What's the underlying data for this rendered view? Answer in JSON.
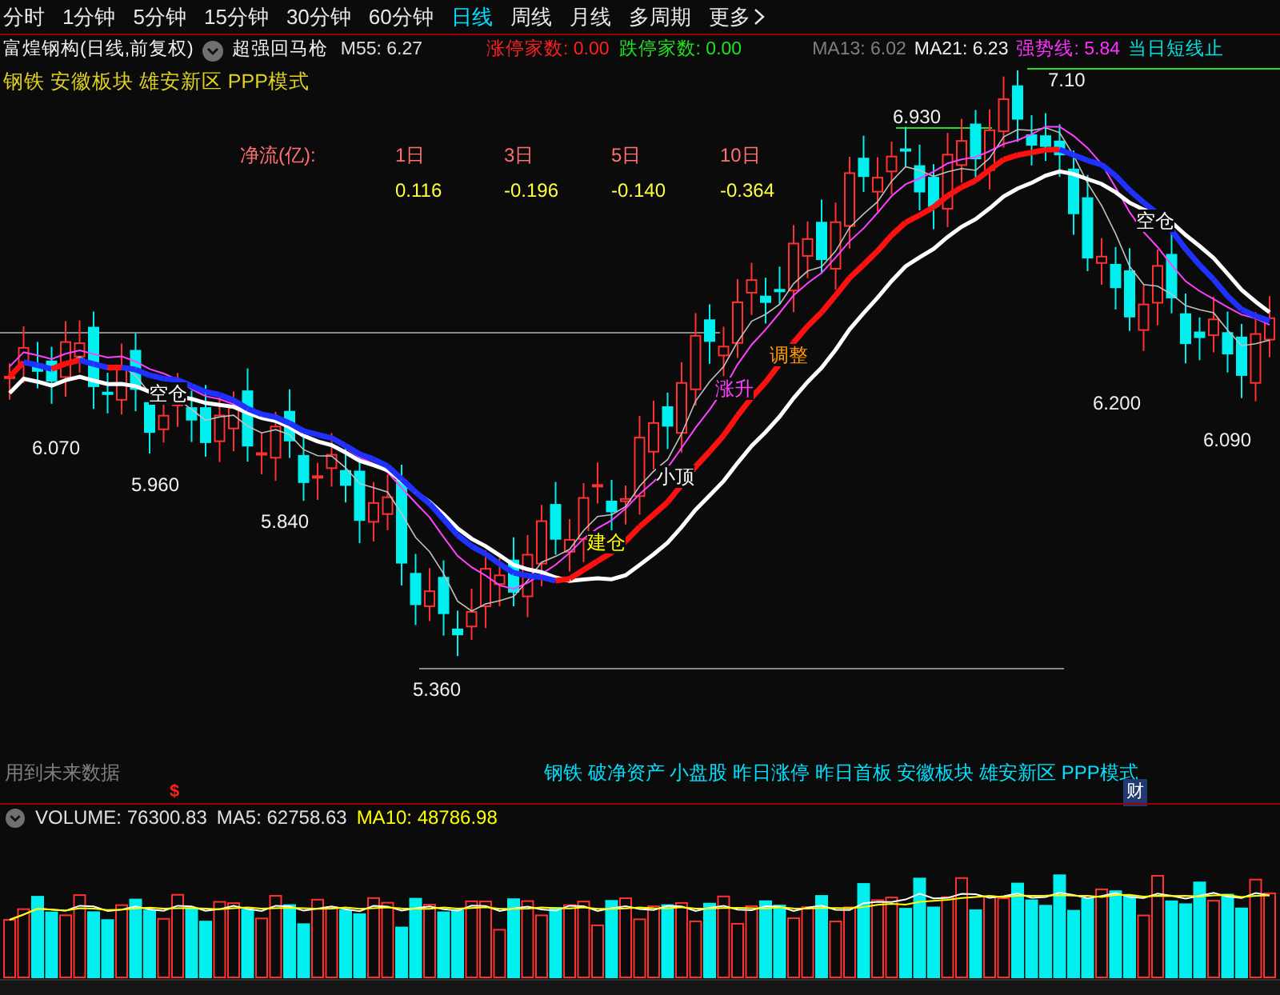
{
  "period_tabs": [
    {
      "label": "分时",
      "kind": "tab",
      "selected": false
    },
    {
      "label": "1分钟",
      "kind": "tab",
      "selected": false
    },
    {
      "label": "5分钟",
      "kind": "tab",
      "selected": false
    },
    {
      "label": "15分钟",
      "kind": "tab",
      "selected": false
    },
    {
      "label": "30分钟",
      "kind": "tab",
      "selected": false
    },
    {
      "label": "60分钟",
      "kind": "tab",
      "selected": false
    },
    {
      "label": "日线",
      "kind": "tab",
      "selected": true
    },
    {
      "label": "周线",
      "kind": "tab",
      "selected": false
    },
    {
      "label": "月线",
      "kind": "tab",
      "selected": false
    },
    {
      "label": "多周期",
      "kind": "tab",
      "selected": false
    },
    {
      "label": "更多",
      "kind": "menu",
      "selected": false
    }
  ],
  "header": {
    "title": "富煌钢构(日线,前复权)",
    "indicator": "超强回马枪",
    "readings": [
      {
        "text": "M55: 6.27",
        "color": "#e0e0e0"
      },
      {
        "text": "涨停家数: 0.00",
        "color": "#ff2020"
      },
      {
        "text": "跌停家数: 0.00",
        "color": "#20e020"
      },
      {
        "text": "MA13: 6.02",
        "color": "#808080"
      },
      {
        "text": "MA21: 6.23",
        "color": "#f0f0f0"
      },
      {
        "text": "强势线: 5.84",
        "color": "#ff30ff"
      },
      {
        "text": "当日短线止",
        "color": "#00e0e0"
      }
    ]
  },
  "sectors": "钢铁 安徽板块 雄安新区 PPP模式",
  "net_flow": {
    "label": "净流(亿):",
    "columns": [
      {
        "period": "1日",
        "value": "0.116"
      },
      {
        "period": "3日",
        "value": "-0.196"
      },
      {
        "period": "5日",
        "value": "-0.140"
      },
      {
        "period": "10日",
        "value": "-0.364"
      }
    ]
  },
  "price_labels": [
    "6.930",
    "7.10",
    "6.200",
    "6.090",
    "6.070",
    "5.960",
    "5.840",
    "5.360"
  ],
  "signals": [
    {
      "text": "空仓",
      "color": "#ffffff"
    },
    {
      "text": "空仓",
      "color": "#ffffff"
    },
    {
      "text": "小顶",
      "color": "#ffffff"
    },
    {
      "text": "建仓",
      "color": "#ffff00"
    },
    {
      "text": "涨升",
      "color": "#ff40ff"
    },
    {
      "text": "调整",
      "color": "#ff9900"
    }
  ],
  "future_data_note": "用到未来数据",
  "marker": "$",
  "tags": "钢铁 破净资产 小盘股 昨日涨停 昨日首板 安徽板块 雄安新区 PPP模式",
  "badge": "财",
  "volume_readings": [
    {
      "text": "VOLUME: 76300.83",
      "color": "#e0e0e0"
    },
    {
      "text": "MA5: 62758.63",
      "color": "#e0e0e0"
    },
    {
      "text": "MA10: 48786.98",
      "color": "#ffff00"
    }
  ]
}
